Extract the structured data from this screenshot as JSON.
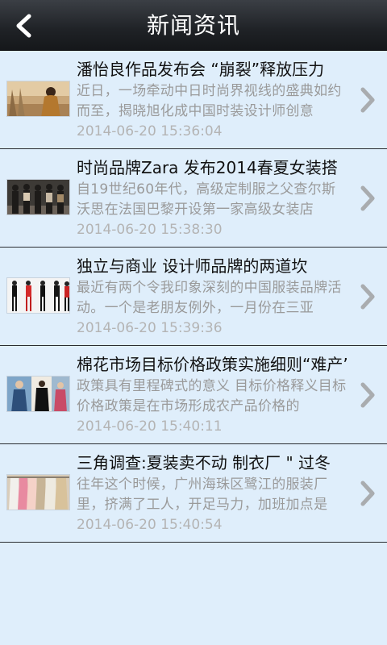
{
  "header": {
    "title": "新闻资讯",
    "back_icon": "chevron-left-icon"
  },
  "news": [
    {
      "title": "潘怡良作品发布会 “崩裂”释放压力",
      "summary": "近日，一场牵动中日时尚界视线的盛典如约而至，揭晓旭化成中国时装设计师创意",
      "time": "2014-06-20 15:36:04",
      "thumb": "photo-model-portrait"
    },
    {
      "title": "时尚品牌Zara 发布2014春夏女装搭",
      "summary": "自19世纪60年代，高级定制服之父查尔斯沃思在法国巴黎开设第一家高级女装店",
      "time": "2014-06-20 15:38:30",
      "thumb": "photo-group-models"
    },
    {
      "title": "独立与商业 设计师品牌的两道坎",
      "summary": "最近有两个令我印象深刻的中国服装品牌活动。一个是老朋友例外，一月份在三亚",
      "time": "2014-06-20 15:39:36",
      "thumb": "photo-runway-models"
    },
    {
      "title": "棉花市场目标价格政策实施细则“难产”",
      "summary": "政策具有里程碑式的意义 目标价格释义目标价格政策是在市场形成农产品价格的",
      "time": "2014-06-20 15:40:11",
      "thumb": "photo-fashion-collage"
    },
    {
      "title": "三角调查:夏装卖不动 制衣厂 \" 过冬",
      "summary": "往年这个时候，广州海珠区鹭江的服装厂里，挤满了工人，开足马力，加班加点是",
      "time": "2014-06-20 15:40:54",
      "thumb": "photo-clothing-rack"
    }
  ],
  "colors": {
    "background": "#dfeefb",
    "header": "#1f2226",
    "title_text": "#111111",
    "summary_text": "#9a9a9a",
    "time_text": "#b4b4b4",
    "divider": "#2a2d31",
    "chevron": "#a9acaf"
  }
}
